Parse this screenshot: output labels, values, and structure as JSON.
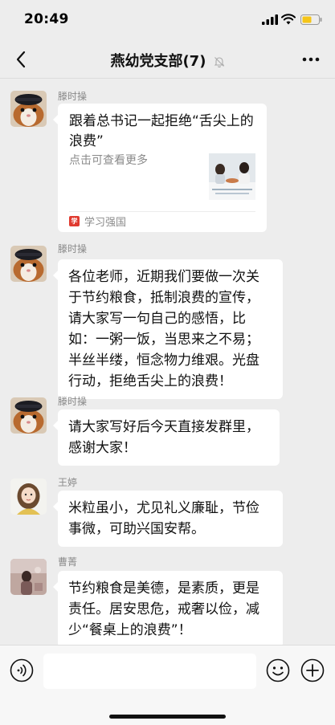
{
  "status_bar": {
    "time": "20:49"
  },
  "nav": {
    "title": "燕幼党支部(7)"
  },
  "messages": [
    {
      "type": "card",
      "sender": "滕时操",
      "avatar": "guinea-pig-avatar",
      "title": "跟着总书记一起拒绝“舌尖上的浪费”",
      "desc": "点击可查看更多",
      "source": "学习强国"
    },
    {
      "type": "text",
      "sender": "滕时操",
      "avatar": "guinea-pig-avatar",
      "lines": [
        "各位老师，近期我们要做一次关",
        "于节约粮食，抵制浪费的宣传，",
        "请大家写一句自己的感悟，比",
        "如：一粥一饭，当思来之不易；",
        "半丝半缕，恒念物力维艰。光盘",
        "行动，拒绝舌尖上的浪费！"
      ]
    },
    {
      "type": "text",
      "sender": "滕时操",
      "avatar": "guinea-pig-avatar",
      "lines": [
        "请大家写好后今天直接发群里，",
        "感谢大家！"
      ]
    },
    {
      "type": "text",
      "sender": "王婷",
      "avatar": "cartoon-girl-avatar",
      "lines": [
        "米粒虽小，尤见礼义廉耻，节俭",
        "事微，可助兴国安帮。"
      ]
    },
    {
      "type": "text",
      "sender": "曹菁",
      "avatar": "photo-avatar",
      "lines": [
        "节约粮食是美德，是素质，更是",
        "责任。居安思危，戒奢以俭，减",
        "少“餐桌上的浪费”！"
      ]
    }
  ],
  "input": {
    "placeholder": ""
  },
  "colors": {
    "background": "#ededed",
    "bubble": "#ffffff",
    "source_logo": "#e03a2f"
  }
}
